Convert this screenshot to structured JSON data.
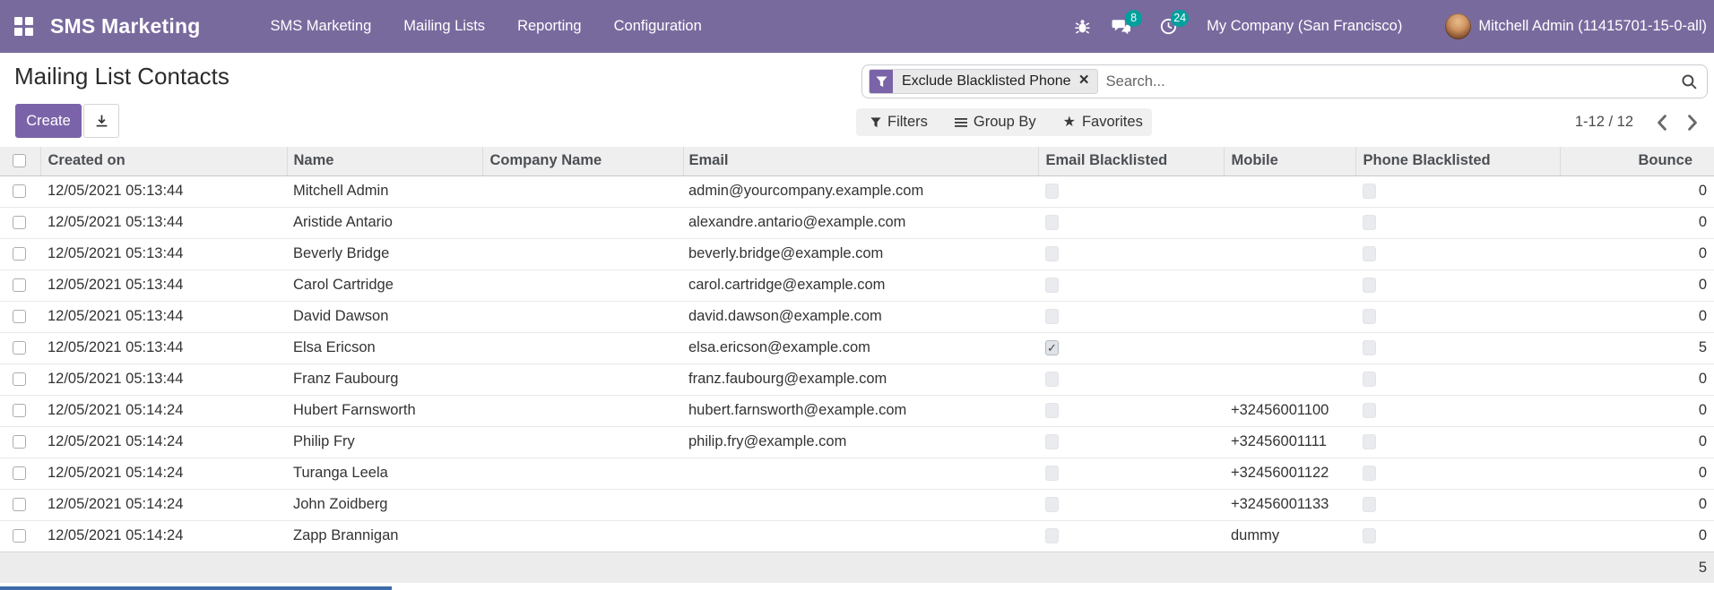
{
  "navbar": {
    "brand": "SMS Marketing",
    "menus": [
      {
        "label": "SMS Marketing"
      },
      {
        "label": "Mailing Lists"
      },
      {
        "label": "Reporting"
      },
      {
        "label": "Configuration"
      }
    ],
    "messages_badge": "8",
    "activities_badge": "24",
    "company": "My Company (San Francisco)",
    "user": "Mitchell Admin (11415701-15-0-all)"
  },
  "page": {
    "title": "Mailing List Contacts"
  },
  "actions": {
    "create_label": "Create",
    "export_icon": "download-icon"
  },
  "search": {
    "facet_label": "Exclude Blacklisted Phone",
    "facet_icon": "filter-funnel-icon",
    "remove_icon": "close-icon",
    "placeholder": "Search...",
    "search_icon": "magnifier-icon"
  },
  "search_options": {
    "filters_label": "Filters",
    "group_by_label": "Group By",
    "favorites_label": "Favorites",
    "filters_icon": "filter-funnel-icon",
    "group_by_icon": "bars-icon",
    "favorites_icon": "star-icon",
    "favorites_glyph": "★"
  },
  "pager": {
    "range": "1-12 / 12"
  },
  "table": {
    "columns": [
      "Created on",
      "Name",
      "Company Name",
      "Email",
      "Email Blacklisted",
      "Mobile",
      "Phone Blacklisted",
      "Bounce"
    ],
    "rows": [
      {
        "created_on": "12/05/2021 05:13:44",
        "name": "Mitchell Admin",
        "company_name": "",
        "email": "admin@yourcompany.example.com",
        "email_blacklisted": false,
        "mobile": "",
        "phone_blacklisted": false,
        "bounce": "0"
      },
      {
        "created_on": "12/05/2021 05:13:44",
        "name": "Aristide Antario",
        "company_name": "",
        "email": "alexandre.antario@example.com",
        "email_blacklisted": false,
        "mobile": "",
        "phone_blacklisted": false,
        "bounce": "0"
      },
      {
        "created_on": "12/05/2021 05:13:44",
        "name": "Beverly Bridge",
        "company_name": "",
        "email": "beverly.bridge@example.com",
        "email_blacklisted": false,
        "mobile": "",
        "phone_blacklisted": false,
        "bounce": "0"
      },
      {
        "created_on": "12/05/2021 05:13:44",
        "name": "Carol Cartridge",
        "company_name": "",
        "email": "carol.cartridge@example.com",
        "email_blacklisted": false,
        "mobile": "",
        "phone_blacklisted": false,
        "bounce": "0"
      },
      {
        "created_on": "12/05/2021 05:13:44",
        "name": "David Dawson",
        "company_name": "",
        "email": "david.dawson@example.com",
        "email_blacklisted": false,
        "mobile": "",
        "phone_blacklisted": false,
        "bounce": "0"
      },
      {
        "created_on": "12/05/2021 05:13:44",
        "name": "Elsa Ericson",
        "company_name": "",
        "email": "elsa.ericson@example.com",
        "email_blacklisted": true,
        "mobile": "",
        "phone_blacklisted": false,
        "bounce": "5"
      },
      {
        "created_on": "12/05/2021 05:13:44",
        "name": "Franz Faubourg",
        "company_name": "",
        "email": "franz.faubourg@example.com",
        "email_blacklisted": false,
        "mobile": "",
        "phone_blacklisted": false,
        "bounce": "0"
      },
      {
        "created_on": "12/05/2021 05:14:24",
        "name": "Hubert Farnsworth",
        "company_name": "",
        "email": "hubert.farnsworth@example.com",
        "email_blacklisted": false,
        "mobile": "+32456001100",
        "phone_blacklisted": false,
        "bounce": "0"
      },
      {
        "created_on": "12/05/2021 05:14:24",
        "name": "Philip Fry",
        "company_name": "",
        "email": "philip.fry@example.com",
        "email_blacklisted": false,
        "mobile": "+32456001111",
        "phone_blacklisted": false,
        "bounce": "0"
      },
      {
        "created_on": "12/05/2021 05:14:24",
        "name": "Turanga Leela",
        "company_name": "",
        "email": "",
        "email_blacklisted": false,
        "mobile": "+32456001122",
        "phone_blacklisted": false,
        "bounce": "0"
      },
      {
        "created_on": "12/05/2021 05:14:24",
        "name": "John Zoidberg",
        "company_name": "",
        "email": "",
        "email_blacklisted": false,
        "mobile": "+32456001133",
        "phone_blacklisted": false,
        "bounce": "0"
      },
      {
        "created_on": "12/05/2021 05:14:24",
        "name": "Zapp Brannigan",
        "company_name": "",
        "email": "",
        "email_blacklisted": false,
        "mobile": "dummy",
        "phone_blacklisted": false,
        "bounce": "0"
      }
    ],
    "bounce_total": "5"
  },
  "colors": {
    "navbar_bg": "#796a9e",
    "accent": "#7a63a8",
    "badge": "#00a09d"
  }
}
